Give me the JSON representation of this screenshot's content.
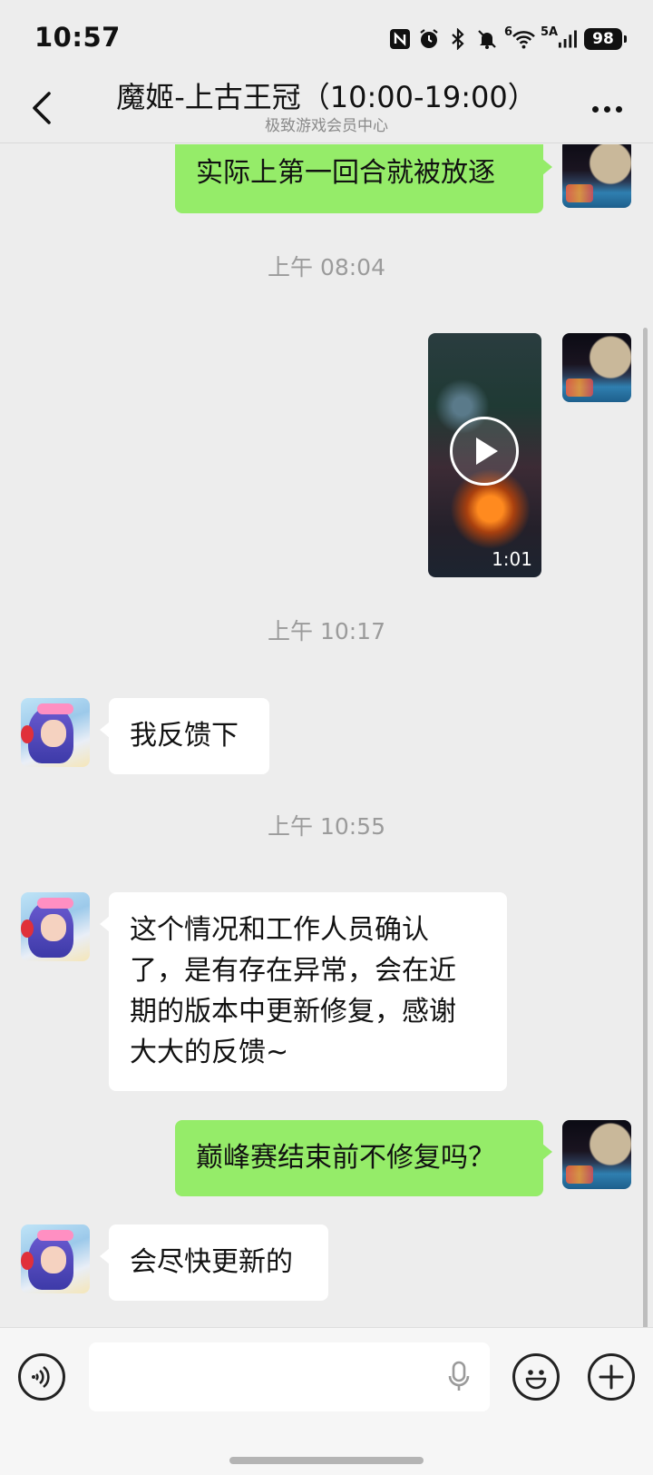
{
  "status_bar": {
    "time": "10:57",
    "network_label": "5A",
    "wifi_label": "6",
    "battery": "98",
    "icons": [
      "nfc-icon",
      "alarm-icon",
      "bluetooth-icon",
      "mute-icon",
      "wifi-icon",
      "signal-icon",
      "battery-icon"
    ]
  },
  "header": {
    "title": "魔姬-上古王冠（10:00-19:00）",
    "subtitle": "极致游戏会员中心",
    "back_icon": "chevron-left-icon",
    "more_icon": "more-icon"
  },
  "messages": [
    {
      "type": "text",
      "from": "self",
      "text": "实际上第一回合就被放逐"
    },
    {
      "type": "time",
      "text": "上午 08:04"
    },
    {
      "type": "video",
      "from": "self",
      "duration": "1:01"
    },
    {
      "type": "time",
      "text": "上午 10:17"
    },
    {
      "type": "text",
      "from": "agent",
      "text": "我反馈下"
    },
    {
      "type": "time",
      "text": "上午 10:55"
    },
    {
      "type": "text",
      "from": "agent",
      "lines": [
        "这个情况和工作人员确认",
        "了，是有存在异常，会在近",
        "期的版本中更新修复，感谢",
        "大大的反馈~"
      ]
    },
    {
      "type": "text",
      "from": "self",
      "text": "巅峰赛结束前不修复吗？"
    },
    {
      "type": "text",
      "from": "agent",
      "text": "会尽快更新的"
    }
  ],
  "input_bar": {
    "text_value": "",
    "voice_icon": "voice-icon",
    "mic_icon": "mic-icon",
    "emoji_icon": "emoji-icon",
    "plus_icon": "plus-icon"
  },
  "colors": {
    "background": "#ededed",
    "outgoing_bubble": "#95ec69",
    "incoming_bubble": "#ffffff",
    "timestamp": "#9b9b9b"
  }
}
